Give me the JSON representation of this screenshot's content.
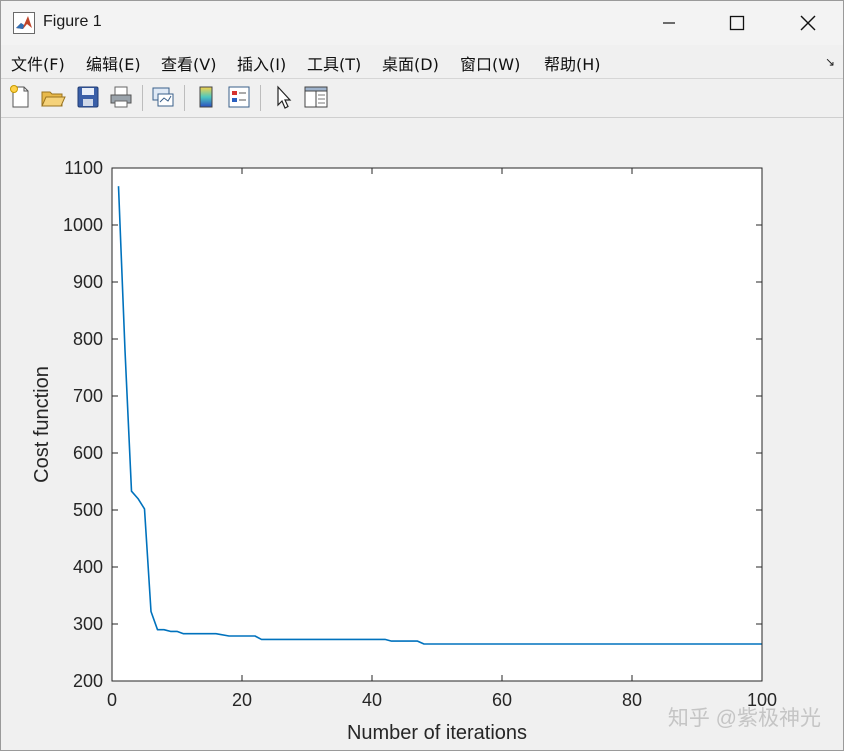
{
  "window": {
    "title": "Figure 1",
    "controls": {
      "minimize": "—",
      "maximize": "☐",
      "close": "✕"
    }
  },
  "menubar": {
    "items": [
      "文件(F)",
      "编辑(E)",
      "查看(V)",
      "插入(I)",
      "工具(T)",
      "桌面(D)",
      "窗口(W)",
      "帮助(H)"
    ],
    "dock_arrow": "↘"
  },
  "toolbar": {
    "buttons": [
      "new-figure-icon",
      "open-folder-icon",
      "save-icon",
      "print-icon",
      "link-plot-icon",
      "colorbar-icon",
      "legend-icon",
      "pointer-icon",
      "property-inspector-icon"
    ]
  },
  "chart_data": {
    "type": "line",
    "title": "",
    "xlabel": "Number of iterations",
    "ylabel": "Cost function",
    "xlim": [
      0,
      100
    ],
    "ylim": [
      200,
      1100
    ],
    "xticks": [
      0,
      20,
      40,
      60,
      80,
      100
    ],
    "yticks": [
      200,
      300,
      400,
      500,
      600,
      700,
      800,
      900,
      1000,
      1100
    ],
    "grid": false,
    "line_color": "#0072bd",
    "series": [
      {
        "x": [
          1,
          2,
          3,
          4,
          5,
          6,
          7,
          8,
          9,
          10,
          11,
          12,
          16,
          18,
          22,
          23,
          42,
          43,
          47,
          48,
          100
        ],
        "y": [
          1068,
          780,
          533,
          520,
          502,
          322,
          290,
          290,
          287,
          287,
          283,
          283,
          283,
          279,
          279,
          273,
          273,
          270,
          270,
          265,
          265
        ]
      }
    ]
  },
  "watermark": "知乎 @紫极神光"
}
